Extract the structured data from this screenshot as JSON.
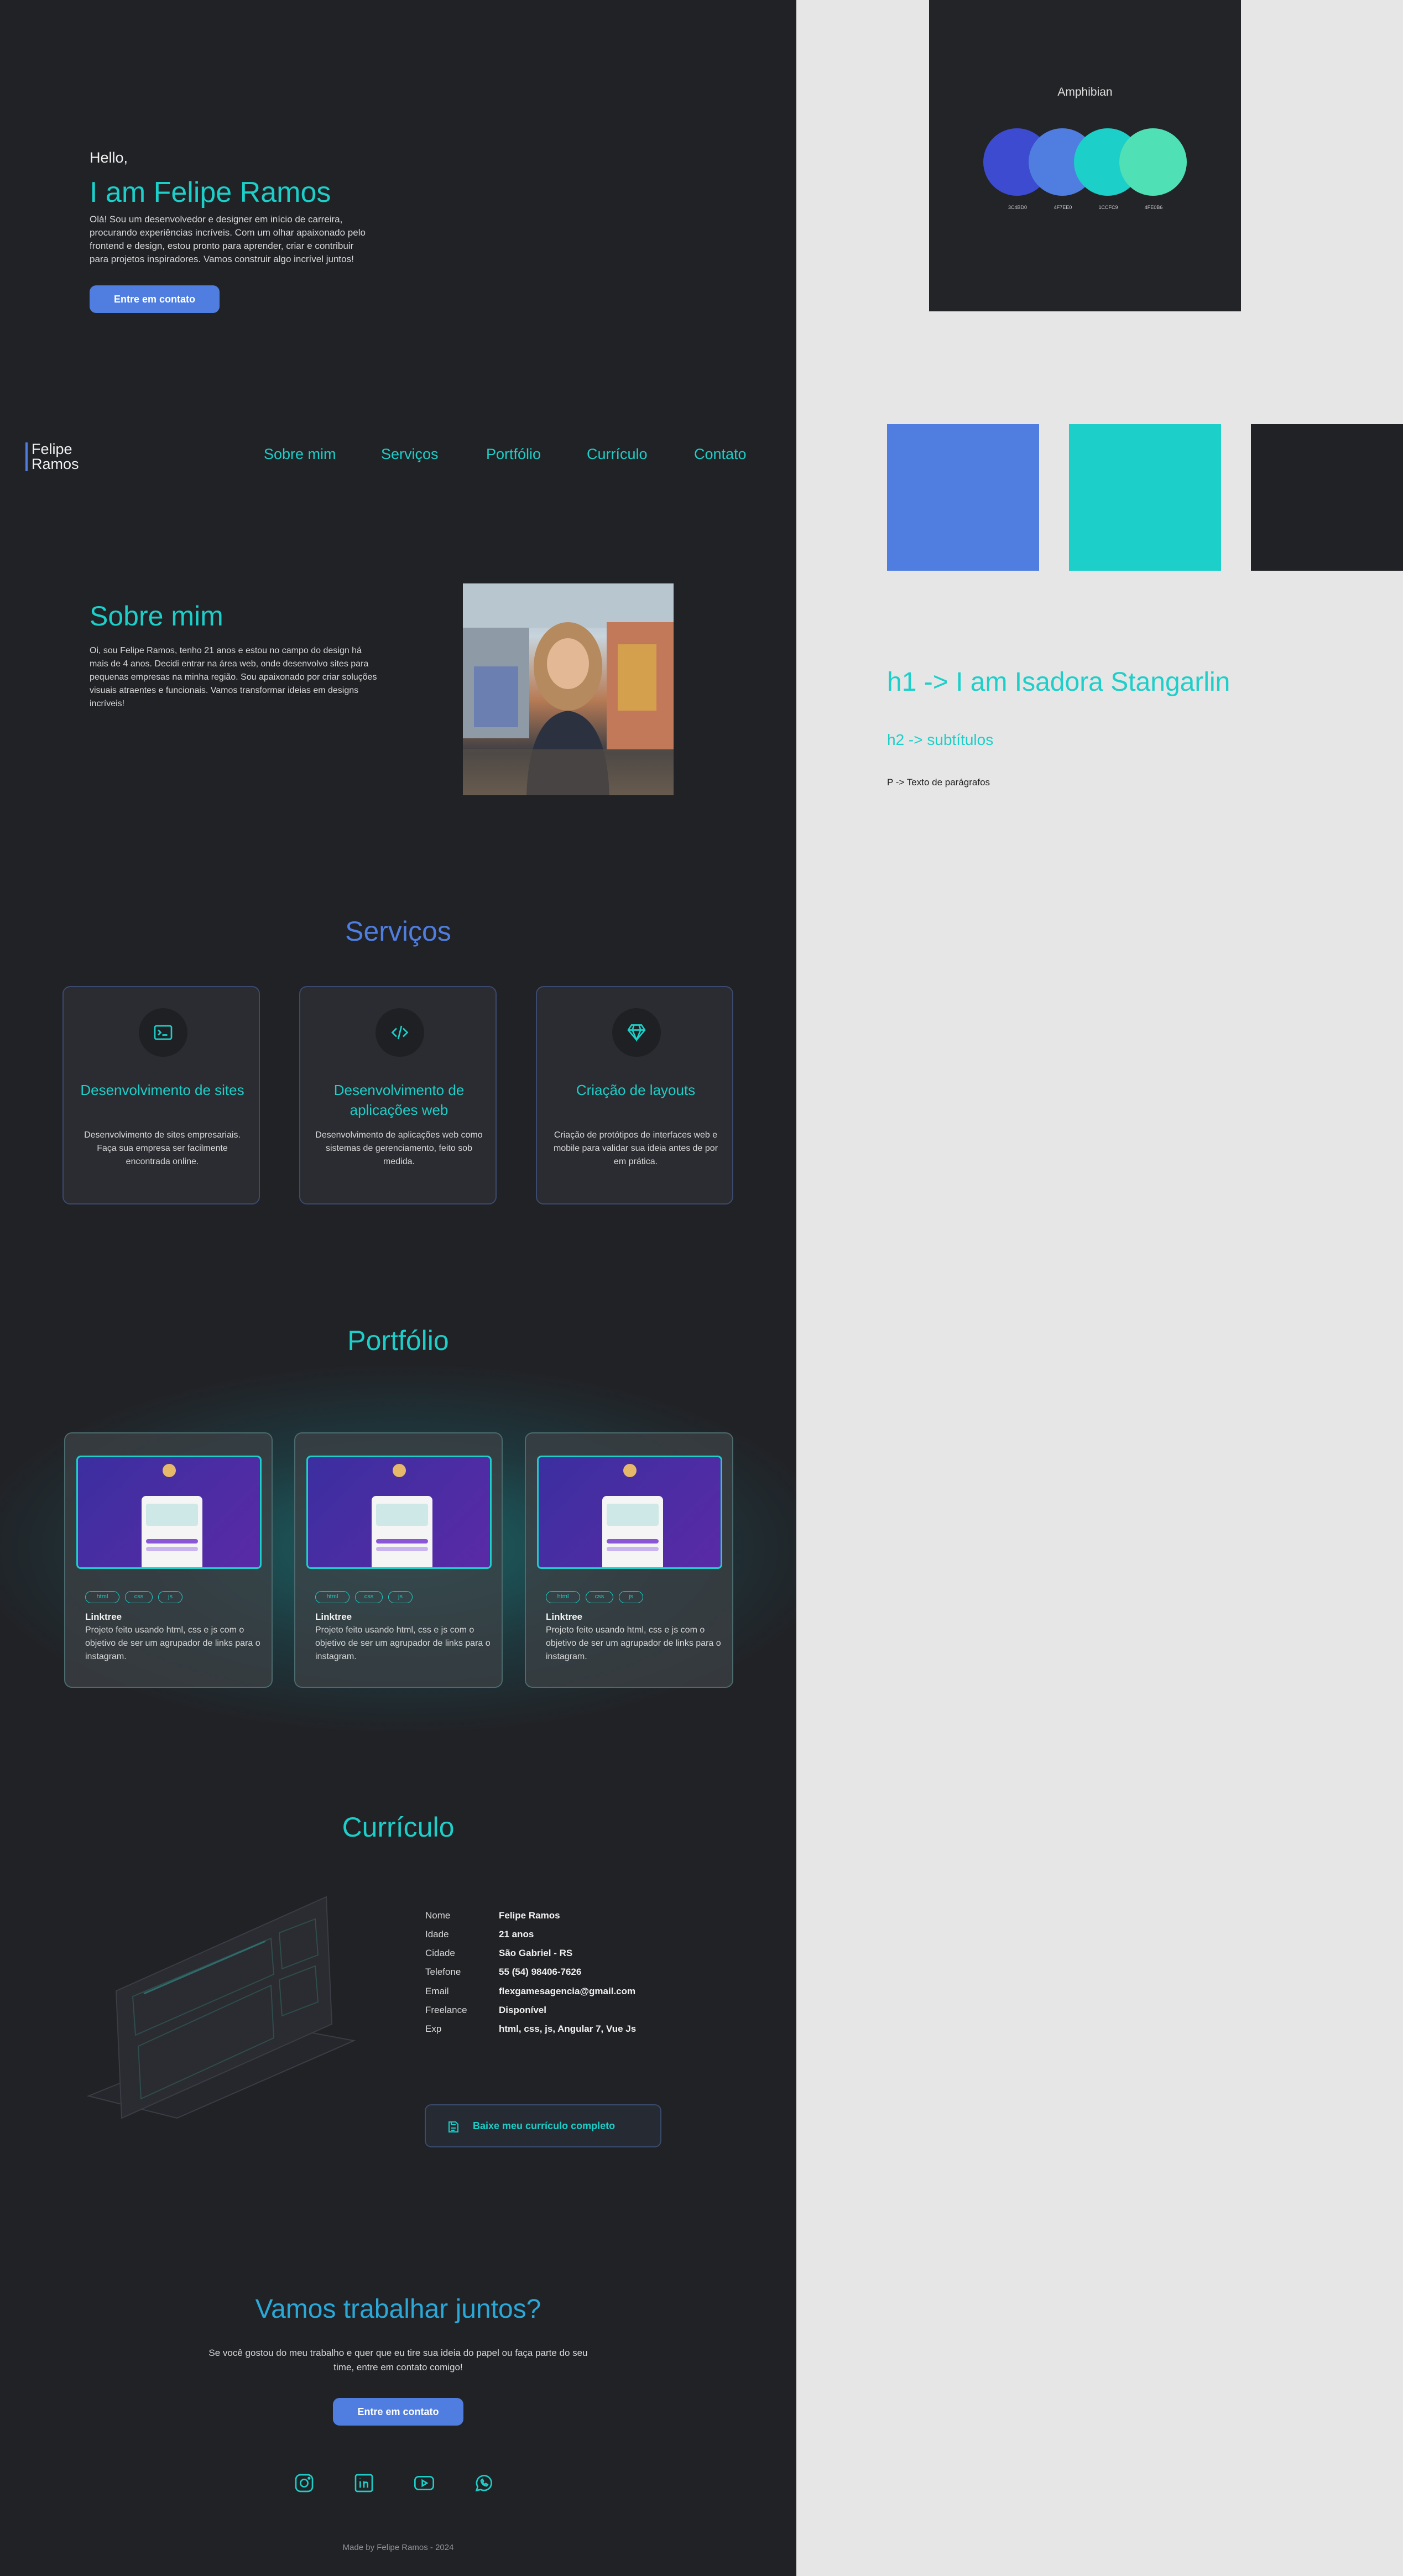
{
  "hero": {
    "greeting": "Hello,",
    "title": "I am Felipe Ramos",
    "text": "Olá! Sou um desenvolvedor e designer em início de carreira, procurando experiências incríveis. Com um olhar apaixonado pelo frontend e design, estou pronto para aprender, criar e contribuir para projetos inspiradores. Vamos construir algo incrível juntos!",
    "button": "Entre em contato"
  },
  "nav": {
    "logo": "Felipe Ramos",
    "items": [
      {
        "label": "Sobre mim"
      },
      {
        "label": "Serviços"
      },
      {
        "label": "Portfólio"
      },
      {
        "label": "Currículo"
      },
      {
        "label": "Contato"
      }
    ]
  },
  "sobre": {
    "title": "Sobre mim",
    "text": "Oi, sou Felipe Ramos, tenho 21 anos e estou no campo do design há mais de 4 anos. Decidi entrar na área web, onde desenvolvo sites para pequenas empresas na minha região. Sou apaixonado por criar soluções visuais atraentes e funcionais. Vamos transformar ideias em designs incríveis!"
  },
  "servicos": {
    "title": "Serviços",
    "cards": [
      {
        "icon": "terminal-icon",
        "title": "Desenvolvimento de sites",
        "text": "Desenvolvimento de sites empresariais. Faça sua empresa ser facilmente encontrada online."
      },
      {
        "icon": "code-icon",
        "title": "Desenvolvimento de aplicações web",
        "text": "Desenvolvimento de aplicações web como sistemas de gerenciamento, feito sob medida."
      },
      {
        "icon": "diamond-icon",
        "title": "Criação de layouts",
        "text": "Criação de protótipos de interfaces web e mobile para validar sua ideia antes de por em prática."
      }
    ]
  },
  "portfolio": {
    "title": "Portfólio",
    "tags": [
      "html",
      "css",
      "js"
    ],
    "cards": [
      {
        "title": "Linktree",
        "text": "Projeto feito usando html, css e js com o objetivo de ser um agrupador de links para o instagram."
      },
      {
        "title": "Linktree",
        "text": "Projeto feito usando html, css e js com o objetivo de ser um agrupador de links para o instagram."
      },
      {
        "title": "Linktree",
        "text": "Projeto feito usando html, css e js com o objetivo de ser um agrupador de links para o instagram."
      }
    ]
  },
  "curriculo": {
    "title": "Currículo",
    "rows": [
      {
        "label": "Nome",
        "value": "Felipe Ramos"
      },
      {
        "label": "Idade",
        "value": "21 anos"
      },
      {
        "label": "Cidade",
        "value": "São Gabriel - RS"
      },
      {
        "label": "Telefone",
        "value": "55 (54) 98406-7626"
      },
      {
        "label": "Email",
        "value": "flexgamesagencia@gmail.com"
      },
      {
        "label": "Freelance",
        "value": "Disponível"
      },
      {
        "label": "Exp",
        "value": "html, css, js, Angular 7, Vue Js"
      }
    ],
    "download": "Baixe meu currículo completo"
  },
  "cta": {
    "title": "Vamos trabalhar juntos?",
    "text": "Se você gostou do meu trabalho e quer que eu tire sua ideia do papel ou faça parte do seu time, entre em contato comigo!",
    "button": "Entre em contato"
  },
  "social": [
    "instagram-icon",
    "linkedin-icon",
    "youtube-icon",
    "whatsapp-icon"
  ],
  "footer": "Made by Felipe Ramos - 2024",
  "styleguide": {
    "palette_title": "Amphibian",
    "palette": [
      {
        "hex": "#3C4BD0",
        "code": "3C4BD0"
      },
      {
        "hex": "#4F7EE0",
        "code": "4F7EE0"
      },
      {
        "hex": "#1CCFC9",
        "code": "1CCFC9"
      },
      {
        "hex": "#4FE0B6",
        "code": "4FE0B6"
      }
    ],
    "swatches": [
      "#4F7EE0",
      "#1CCFC9",
      "#212226"
    ],
    "h1": "h1 -> I am Isadora Stangarlin",
    "h2": "h2 -> subtítulos",
    "p": "P -> Texto de parágrafos"
  }
}
